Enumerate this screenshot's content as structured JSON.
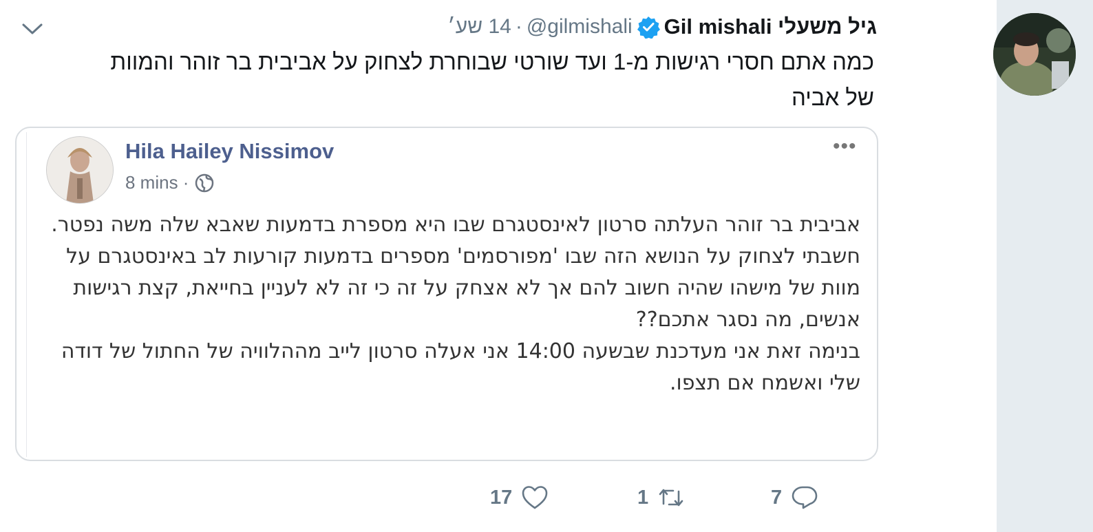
{
  "tweet": {
    "display_name": "Gil mishali גיל משעלי",
    "handle": "@gilmishali",
    "time": "14 שע׳",
    "separator": "·",
    "text_line1": "כמה אתם חסרי רגישות מ-1 ועד שורטי שבוחרת לצחוק על אביבית בר זוהר והמוות",
    "text_line2": "של אביה"
  },
  "embedded_post": {
    "author": "Hila Hailey Nissimov",
    "time": "8 mins ·",
    "more": "•••",
    "paragraphs": [
      "אביבית בר זוהר העלתה סרטון לאינסטגרם שבו היא מספרת בדמעות שאבא שלה משה נפטר.",
      "חשבתי לצחוק על הנושא הזה שבו 'מפורסמים' מספרים בדמעות קורעות לב באינסטגרם על מוות של מישהו שהיה חשוב להם אך לא אצחק על זה כי זה לא לעניין בחייאת, קצת רגישות אנשים, מה נסגר אתכם??",
      "בנימה זאת אני מעדכנת שבשעה 14:00 אני אעלה סרטון לייב מההלוויה של החתול של דודה שלי ואשמח אם תצפו."
    ]
  },
  "actions": {
    "likes": "17",
    "retweets": "1",
    "replies": "7"
  },
  "icons": [
    "chevron-down-icon",
    "verified-badge-icon",
    "globe-icon",
    "heart-icon",
    "retweet-icon",
    "reply-icon"
  ],
  "colors": {
    "verified": "#1da1f2",
    "muted": "#657786",
    "fb_name": "#4d5f8e",
    "sidebar": "#e6ecf0"
  }
}
